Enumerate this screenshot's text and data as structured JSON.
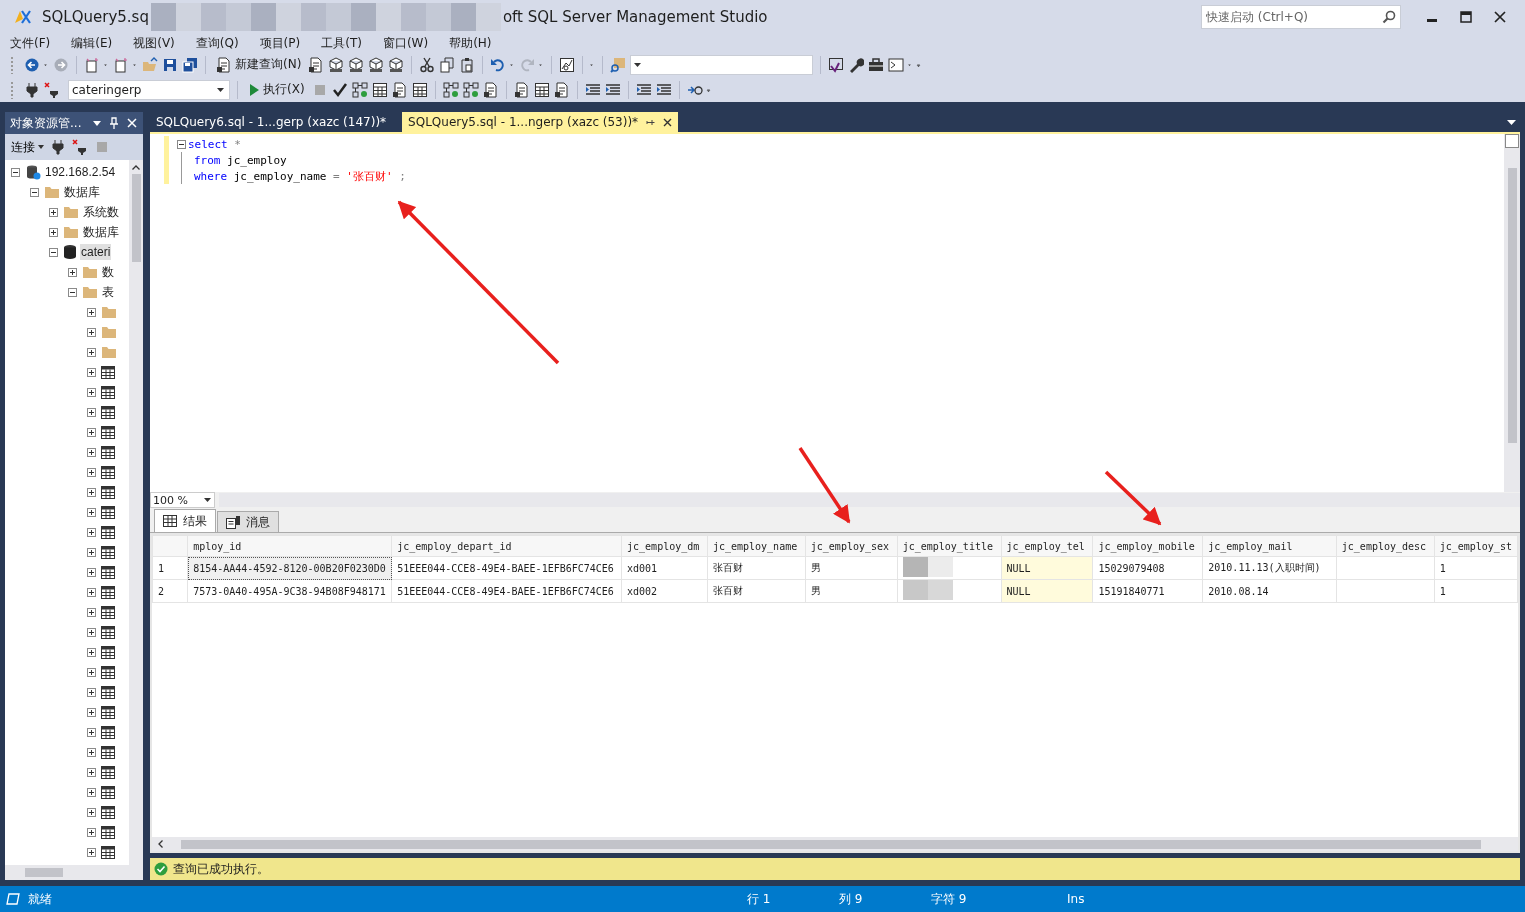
{
  "window": {
    "title_start": "SQLQuery5.sq",
    "title_end": "oft SQL Server Management Studio",
    "quick_launch": {
      "placeholder": "快速启动 (Ctrl+Q)"
    }
  },
  "menu": [
    "文件(F)",
    "编辑(E)",
    "视图(V)",
    "查询(Q)",
    "项目(P)",
    "工具(T)",
    "窗口(W)",
    "帮助(H)"
  ],
  "toolbar": {
    "new_query": "新建查询(N)",
    "database": "cateringerp",
    "execute": "执行(X)"
  },
  "object_explorer": {
    "title": "对象资源管...",
    "connect": "连接",
    "tree": [
      {
        "label": "192.168.2.54",
        "kind": "server",
        "expanded": true,
        "selected": false,
        "children": [
          {
            "label": "数据库",
            "kind": "folder",
            "expanded": true,
            "selected": false,
            "children": [
              {
                "label": "系统数",
                "kind": "folder",
                "expanded": false,
                "selected": false
              },
              {
                "label": "数据库",
                "kind": "folder",
                "expanded": false,
                "selected": false
              },
              {
                "label": "cateri",
                "kind": "database",
                "expanded": true,
                "selected": true,
                "children": [
                  {
                    "label": "数",
                    "kind": "folder",
                    "expanded": false,
                    "selected": false
                  },
                  {
                    "label": "表",
                    "kind": "folder",
                    "expanded": true,
                    "selected": false,
                    "children": [
                      {
                        "kind": "folder",
                        "expanded": false,
                        "selected": false
                      },
                      {
                        "kind": "folder",
                        "expanded": false,
                        "selected": false
                      },
                      {
                        "kind": "folder",
                        "expanded": false,
                        "selected": false
                      },
                      {
                        "kind": "table",
                        "expanded": false,
                        "selected": false
                      },
                      {
                        "kind": "table",
                        "expanded": false,
                        "selected": false
                      },
                      {
                        "kind": "table",
                        "expanded": false,
                        "selected": false
                      },
                      {
                        "kind": "table",
                        "expanded": false,
                        "selected": false
                      },
                      {
                        "kind": "table",
                        "expanded": false,
                        "selected": false
                      },
                      {
                        "kind": "table",
                        "expanded": false,
                        "selected": false
                      },
                      {
                        "kind": "table",
                        "expanded": false,
                        "selected": false
                      },
                      {
                        "kind": "table",
                        "expanded": false,
                        "selected": false
                      },
                      {
                        "kind": "table",
                        "expanded": false,
                        "selected": false
                      },
                      {
                        "kind": "table",
                        "expanded": false,
                        "selected": false
                      },
                      {
                        "kind": "table",
                        "expanded": false,
                        "selected": false
                      },
                      {
                        "kind": "table",
                        "expanded": false,
                        "selected": false
                      },
                      {
                        "kind": "table",
                        "expanded": false,
                        "selected": false
                      },
                      {
                        "kind": "table",
                        "expanded": false,
                        "selected": false
                      },
                      {
                        "kind": "table",
                        "expanded": false,
                        "selected": false
                      },
                      {
                        "kind": "table",
                        "expanded": false,
                        "selected": false
                      },
                      {
                        "kind": "table",
                        "expanded": false,
                        "selected": false
                      },
                      {
                        "kind": "table",
                        "expanded": false,
                        "selected": false
                      },
                      {
                        "kind": "table",
                        "expanded": false,
                        "selected": false
                      },
                      {
                        "kind": "table",
                        "expanded": false,
                        "selected": false
                      },
                      {
                        "kind": "table",
                        "expanded": false,
                        "selected": false
                      },
                      {
                        "kind": "table",
                        "expanded": false,
                        "selected": false
                      },
                      {
                        "kind": "table",
                        "expanded": false,
                        "selected": false
                      },
                      {
                        "kind": "table",
                        "expanded": false,
                        "selected": false
                      },
                      {
                        "kind": "table",
                        "expanded": false,
                        "selected": false
                      }
                    ]
                  }
                ]
              }
            ]
          }
        ]
      }
    ]
  },
  "tabs": [
    {
      "label": "SQLQuery6.sql - 1...gerp (xazc (147))*",
      "selected": false
    },
    {
      "label": "SQLQuery5.sql - 1...ngerp (xazc (53))*",
      "selected": true
    }
  ],
  "editor": {
    "lines": [
      [
        {
          "text": "select",
          "kind": "keyword"
        },
        {
          "text": " *",
          "kind": "operator"
        }
      ],
      [
        {
          "text": "from",
          "kind": "keyword"
        },
        {
          "text": " jc_employ",
          "kind": "plain"
        }
      ],
      [
        {
          "text": "where",
          "kind": "keyword"
        },
        {
          "text": " jc_employ_name ",
          "kind": "plain"
        },
        {
          "text": "= ",
          "kind": "operator"
        },
        {
          "text": "'张百财'",
          "kind": "string"
        },
        {
          "text": " ;",
          "kind": "operator"
        }
      ]
    ],
    "zoom": "100 %"
  },
  "results": {
    "tabs": [
      {
        "label": "结果",
        "selected": true
      },
      {
        "label": "消息",
        "selected": false
      }
    ],
    "columns": [
      "mploy_id",
      "jc_employ_depart_id",
      "jc_employ_dm",
      "jc_employ_name",
      "jc_employ_sex",
      "jc_employ_title",
      "jc_employ_tel",
      "jc_employ_mobile",
      "jc_employ_mail",
      "jc_employ_desc",
      "jc_employ_st"
    ],
    "rows": [
      {
        "number": "1",
        "cells": [
          {
            "kind": "text",
            "text": "8154-AA44-4592-8120-00B20F0230D0"
          },
          {
            "kind": "text",
            "text": "51EEE044-CCE8-49E4-BAEE-1EFB6FC74CE6"
          },
          {
            "kind": "text",
            "text": "xd001"
          },
          {
            "kind": "text",
            "text": "张百财"
          },
          {
            "kind": "text",
            "text": "男"
          },
          {
            "kind": "redacted"
          },
          {
            "kind": "null",
            "text": "NULL"
          },
          {
            "kind": "text",
            "text": "15029079408"
          },
          {
            "kind": "text",
            "text": "2010.11.13(入职时间)"
          },
          {
            "kind": "empty"
          },
          {
            "kind": "text",
            "text": "1"
          }
        ]
      },
      {
        "number": "2",
        "cells": [
          {
            "kind": "text",
            "text": "7573-0A40-495A-9C38-94B08F948171"
          },
          {
            "kind": "text",
            "text": "51EEE044-CCE8-49E4-BAEE-1EFB6FC74CE6"
          },
          {
            "kind": "text",
            "text": "xd002"
          },
          {
            "kind": "text",
            "text": "张百财"
          },
          {
            "kind": "text",
            "text": "男"
          },
          {
            "kind": "redacted"
          },
          {
            "kind": "null",
            "text": "NULL"
          },
          {
            "kind": "text",
            "text": "15191840771"
          },
          {
            "kind": "text",
            "text": "2010.08.14"
          },
          {
            "kind": "empty"
          },
          {
            "kind": "text",
            "text": "1"
          }
        ]
      }
    ],
    "message": "查询已成功执行。"
  },
  "status_bar": {
    "state": "就绪",
    "line": "行 1",
    "column": "列 9",
    "char": "字符 9",
    "mode": "Ins"
  }
}
